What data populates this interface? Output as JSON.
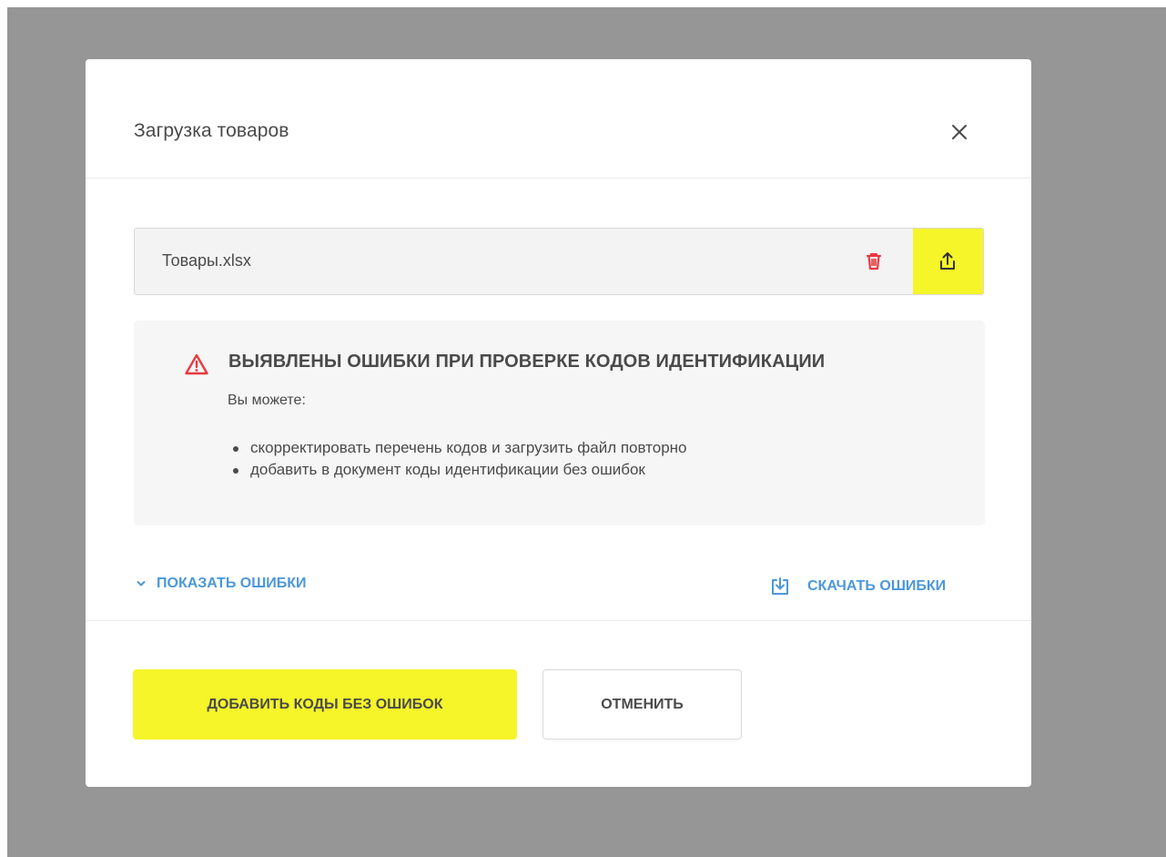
{
  "modal": {
    "title": "Загрузка товаров",
    "close_icon": "close-icon"
  },
  "file": {
    "name": "Товары.xlsx",
    "delete_icon": "trash-icon",
    "upload_icon": "upload-icon"
  },
  "errors": {
    "title": "ВЫЯВЛЕНЫ ОШИБКИ ПРИ ПРОВЕРКЕ КОДОВ ИДЕНТИФИКАЦИИ",
    "subtitle": "Вы можете:",
    "options": [
      "скорректировать перечень кодов и загрузить файл повторно",
      "добавить в документ коды идентификации без ошибок"
    ]
  },
  "links": {
    "show_errors": "ПОКАЗАТЬ ОШИБКИ",
    "download_errors": "СКАЧАТЬ ОШИБКИ"
  },
  "footer": {
    "primary_label": "ДОБАВИТЬ КОДЫ БЕЗ ОШИБОК",
    "cancel_label": "ОТМЕНИТЬ"
  },
  "colors": {
    "accent": "#f5f52a",
    "link": "#4b97dc",
    "danger": "#e8393f",
    "text": "#4a4a4a"
  }
}
